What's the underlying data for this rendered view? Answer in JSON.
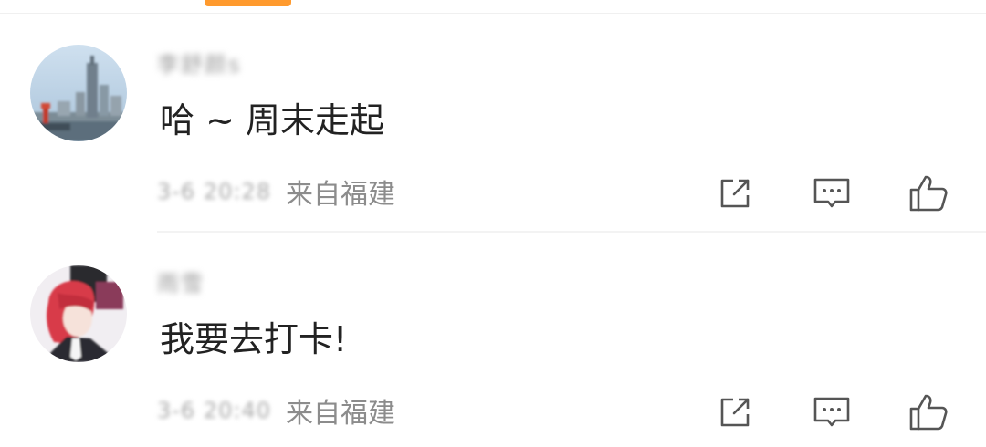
{
  "accent_color": "#ff9a2e",
  "icons": {
    "share": "share-icon",
    "comment": "comment-icon",
    "like": "thumbs-up-icon"
  },
  "comments": [
    {
      "username": "李舒颜s",
      "text": "哈 ~ 周末走起",
      "timestamp": "3-6 20:28",
      "location": "来自福建"
    },
    {
      "username": "雨雪",
      "text": "我要去打卡!",
      "timestamp": "3-6 20:40",
      "location": "来自福建"
    }
  ]
}
